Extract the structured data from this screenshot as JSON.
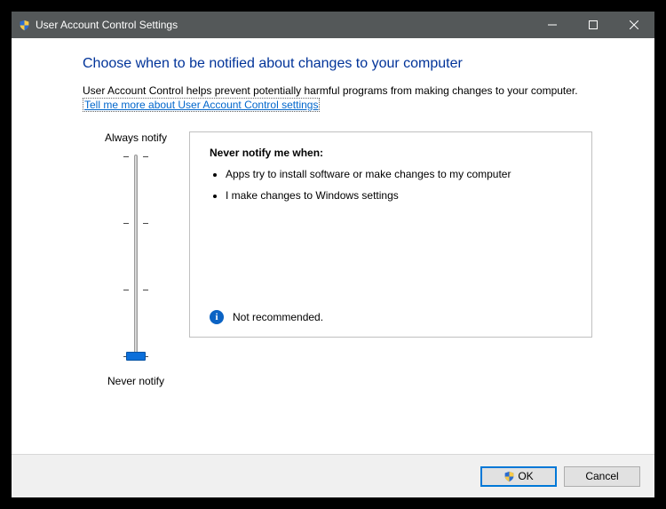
{
  "window": {
    "title": "User Account Control Settings"
  },
  "heading": "Choose when to be notified about changes to your computer",
  "subtext": "User Account Control helps prevent potentially harmful programs from making changes to your computer.",
  "link": "Tell me more about User Account Control settings",
  "slider": {
    "top_label": "Always notify",
    "bottom_label": "Never notify",
    "levels": 4,
    "current_level": 0
  },
  "description": {
    "title": "Never notify me when:",
    "bullets": [
      "Apps try to install software or make changes to my computer",
      "I make changes to Windows settings"
    ],
    "note": "Not recommended."
  },
  "buttons": {
    "ok": "OK",
    "cancel": "Cancel"
  }
}
